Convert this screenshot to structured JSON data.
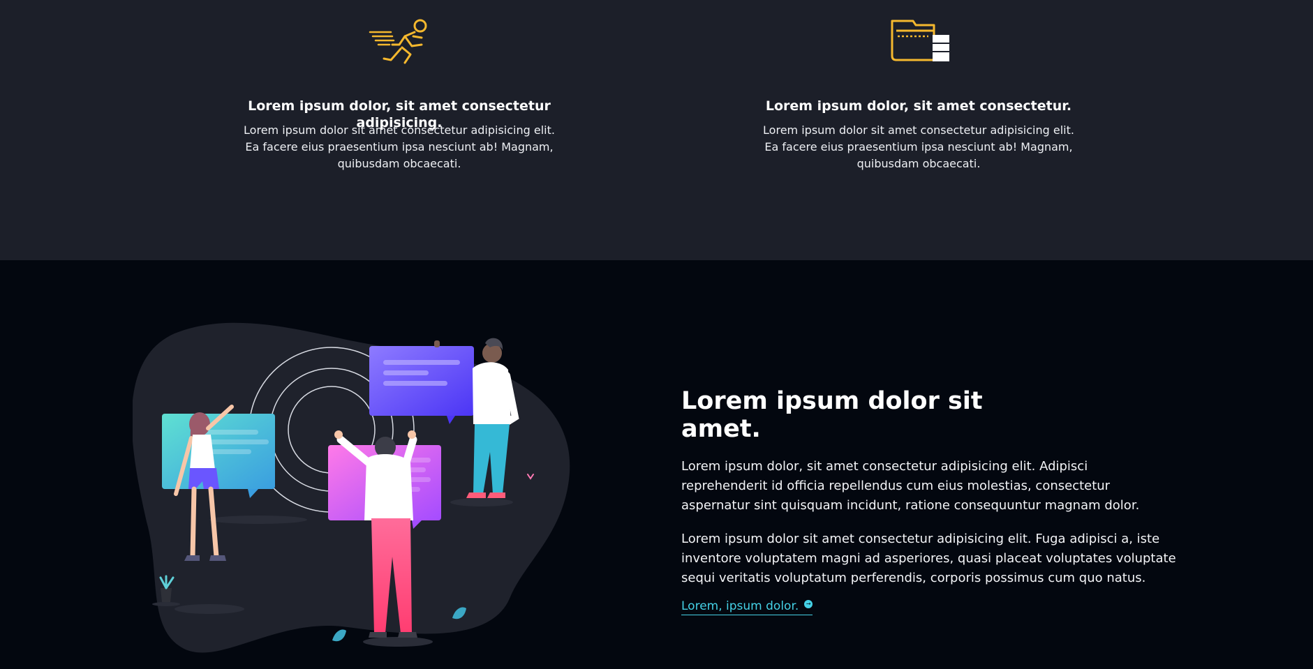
{
  "features": [
    {
      "icon": "running-person-icon",
      "title": "Lorem ipsum dolor, sit amet consectetur adipisicing.",
      "text": "Lorem ipsum dolor sit amet consectetur adipisicing elit. Ea facere eius praesentium ipsa nesciunt ab! Magnam, quibusdam obcaecati."
    },
    {
      "icon": "folder-server-icon",
      "title": "Lorem ipsum dolor, sit amet consectetur.",
      "text": "Lorem ipsum dolor sit amet consectetur adipisicing elit. Ea facere eius praesentium ipsa nesciunt ab! Magnam, quibusdam obcaecati."
    }
  ],
  "showcase": {
    "heading": "Lorem ipsum dolor sit amet.",
    "paragraphs": [
      "Lorem ipsum dolor, sit amet consectetur adipisicing elit. Adipisci reprehenderit id officia repellendus cum eius molestias, consectetur aspernatur sint quisquam incidunt, ratione consequuntur magnam dolor.",
      "Lorem ipsum dolor sit amet consectetur adipisicing elit. Fuga adipisci a, iste inventore voluptatem magni ad asperiores, quasi placeat voluptates voluptate sequi veritatis voluptatum perferendis, corporis possimus cum quo natus."
    ],
    "link_label": "Lorem, ipsum dolor.",
    "link_icon": "arrow-circle-icon"
  },
  "colors": {
    "accent_yellow": "#f5b82e",
    "accent_cyan": "#45d1e6",
    "top_bg": "#1c1f29",
    "bottom_bg": "#03070f"
  }
}
